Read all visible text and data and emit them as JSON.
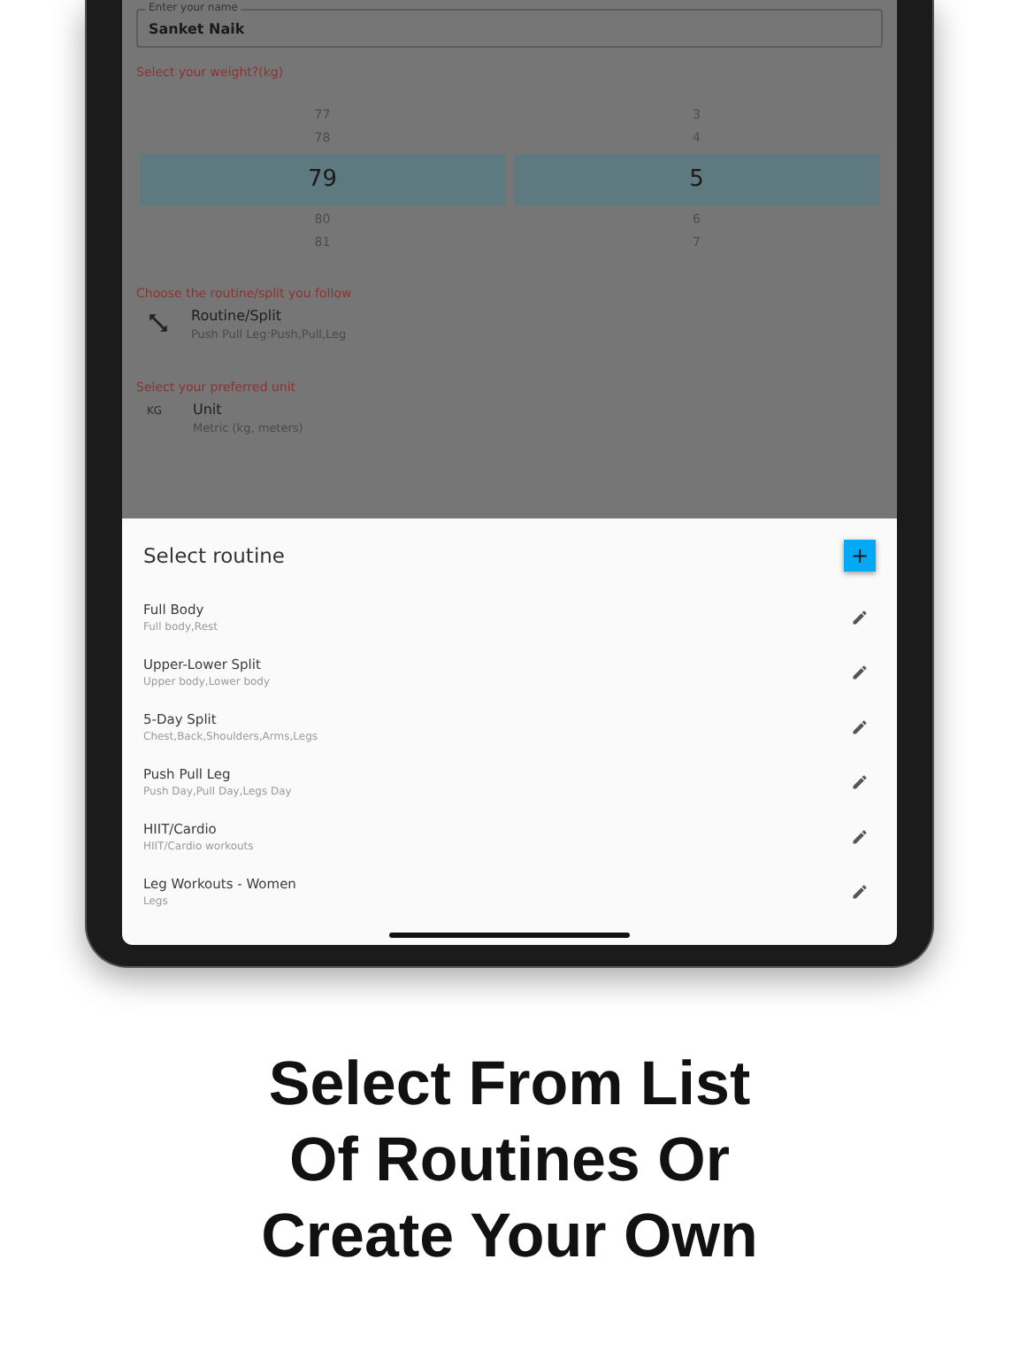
{
  "name_field": {
    "label": "Enter your name",
    "value": "Sanket Naik"
  },
  "weight": {
    "label": "Select your weight?(kg)",
    "columns": [
      {
        "items": [
          {
            "text": "77",
            "selected": false
          },
          {
            "text": "78",
            "selected": false
          },
          {
            "text": "79",
            "selected": true
          },
          {
            "text": "80",
            "selected": false
          },
          {
            "text": "81",
            "selected": false
          }
        ]
      },
      {
        "items": [
          {
            "text": "3",
            "selected": false
          },
          {
            "text": "4",
            "selected": false
          },
          {
            "text": "5",
            "selected": true
          },
          {
            "text": "6",
            "selected": false
          },
          {
            "text": "7",
            "selected": false
          }
        ]
      }
    ]
  },
  "routine_setting": {
    "label": "Choose the routine/split you follow",
    "title": "Routine/Split",
    "subtitle": "Push Pull Leg:Push,Pull,Leg"
  },
  "unit_setting": {
    "label": "Select your preferred unit",
    "icon_text": "KG",
    "title": "Unit",
    "subtitle": "Metric (kg, meters)"
  },
  "sheet": {
    "title": "Select routine",
    "add_button": "+",
    "routines": [
      {
        "name": "Full Body",
        "days": "Full body,Rest"
      },
      {
        "name": "Upper-Lower Split",
        "days": "Upper body,Lower body"
      },
      {
        "name": "5-Day Split",
        "days": "Chest,Back,Shoulders,Arms,Legs"
      },
      {
        "name": "Push Pull Leg",
        "days": "Push Day,Pull Day,Legs Day"
      },
      {
        "name": "HIIT/Cardio",
        "days": "HIIT/Cardio workouts"
      },
      {
        "name": "Leg Workouts - Women",
        "days": "Legs"
      }
    ]
  },
  "caption": [
    "Select From List",
    "Of Routines Or",
    "Create Your Own"
  ]
}
